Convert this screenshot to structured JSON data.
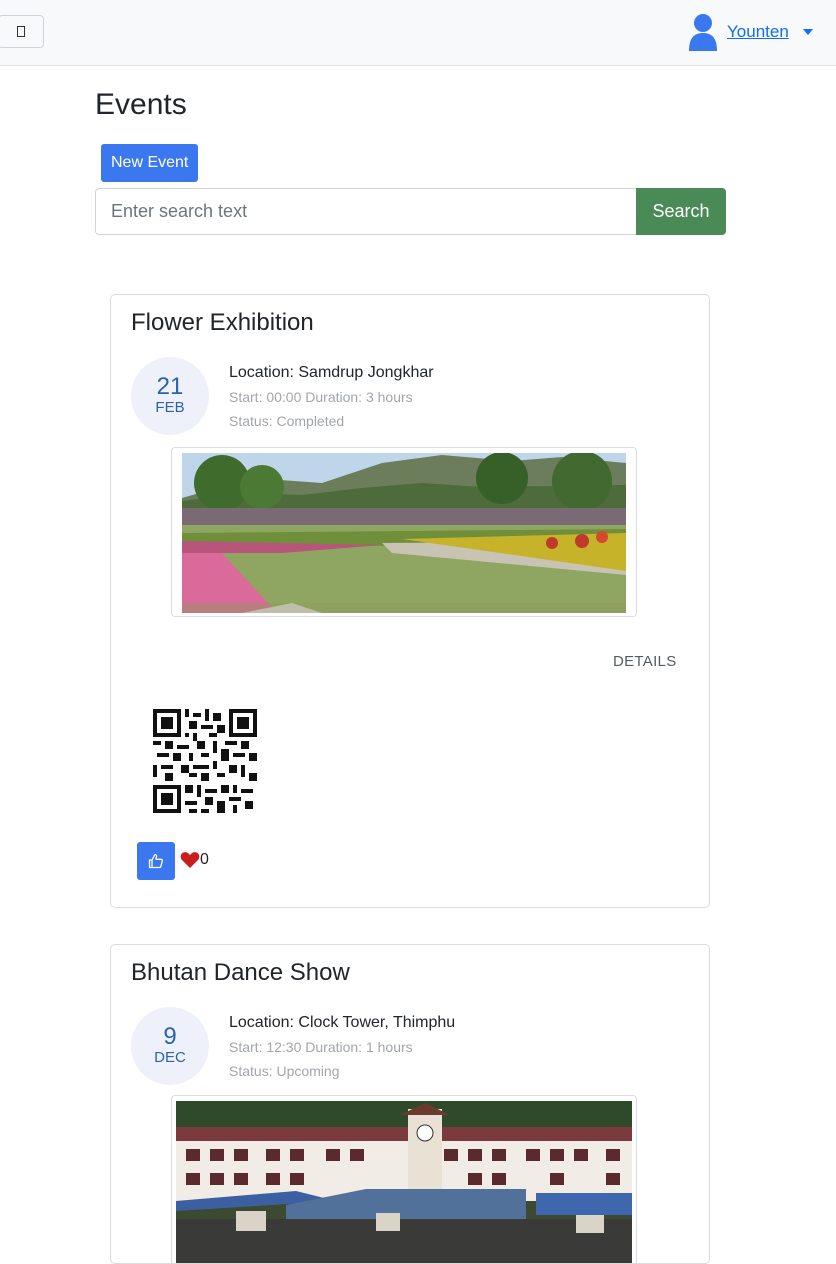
{
  "navbar": {
    "toggle_icon": "sidebar-toggle-icon",
    "user_icon": "user-icon",
    "user_name": "Younten"
  },
  "page": {
    "title": "Events",
    "new_event_label": "New Event",
    "search_placeholder": "Enter search text",
    "search_label": "Search"
  },
  "events": [
    {
      "title": "Flower Exhibition",
      "day": "21",
      "month": "FEB",
      "location": "Location: Samdrup Jongkhar",
      "timing": "Start: 00:00 Duration: 3 hours",
      "status": "Status: Completed",
      "details_label": "DETAILS",
      "likes": "0"
    },
    {
      "title": "Bhutan Dance Show",
      "day": "9",
      "month": "DEC",
      "location": "Location: Clock Tower, Thimphu",
      "timing": "Start: 12:30 Duration: 1 hours",
      "status": "Status: Upcoming"
    }
  ],
  "colors": {
    "primary": "#3b78f0",
    "search_button": "#4a8a57",
    "heart": "#c81e1e",
    "date_text": "#2c63a8"
  }
}
